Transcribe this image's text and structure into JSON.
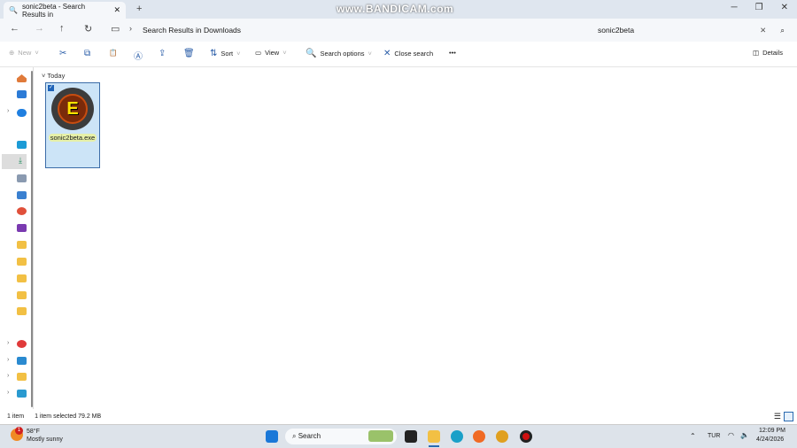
{
  "window": {
    "tab_title": "sonic2beta - Search Results in",
    "watermark": "www.BANDICAM.com"
  },
  "address": {
    "breadcrumb": "Search Results in Downloads",
    "search_value": "sonic2beta"
  },
  "toolbar": {
    "new": "New",
    "sort": "Sort",
    "view": "View",
    "search_options": "Search options",
    "close_search": "Close search",
    "more": "•••",
    "details": "Details"
  },
  "content": {
    "group": "Today",
    "files": [
      {
        "name": "sonic2beta.exe",
        "icon_letter": "E",
        "selected": true
      }
    ]
  },
  "status": {
    "count": "1 item",
    "selection": "1 item selected  79.2 MB"
  },
  "taskbar": {
    "weather_temp": "58°F",
    "weather_desc": "Mostly sunny",
    "weather_badge": "1",
    "search": "Search",
    "lang": "TUR",
    "time": "12:09 PM",
    "date": "4/24/2026"
  }
}
